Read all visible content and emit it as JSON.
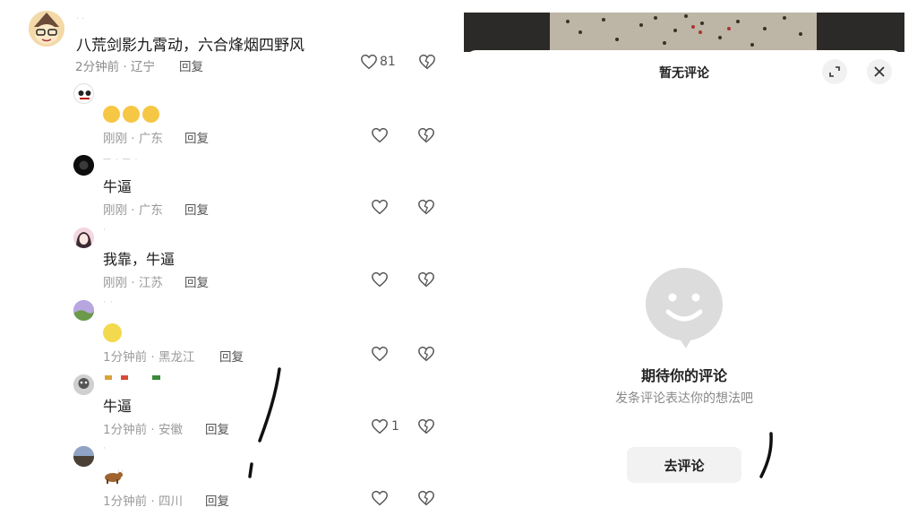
{
  "left": {
    "top_comment": {
      "username": "· ·",
      "text": "八荒剑影九霄动，六合烽烟四野风",
      "meta": "2分钟前 · 辽宁",
      "reply_label": "回复",
      "like_count": "81",
      "avatar_icon": "cartoon-avatar"
    },
    "replies": [
      {
        "username": "",
        "emojis": [
          "fearful-face-emoji",
          "fearful-face-emoji",
          "fearful-face-emoji"
        ],
        "text": "",
        "meta": "刚刚 · 广东",
        "reply_label": "回复",
        "like_count": ""
      },
      {
        "username": "一 · 一 ·",
        "emojis": [],
        "text": "牛逼",
        "meta": "刚刚 · 广东",
        "reply_label": "回复",
        "like_count": ""
      },
      {
        "username": "·",
        "emojis": [],
        "text": "我靠，牛逼",
        "meta": "刚刚 · 江苏",
        "reply_label": "回复",
        "like_count": ""
      },
      {
        "username": "· ·",
        "emojis": [
          "smiling-face-emoji"
        ],
        "text": "",
        "meta": "1分钟前 · 黑龙江",
        "reply_label": "回复",
        "like_count": ""
      },
      {
        "username": "",
        "emojis": [],
        "text": "牛逼",
        "meta": "1分钟前 · 安徽",
        "reply_label": "回复",
        "like_count": "1"
      },
      {
        "username": "·",
        "emojis": [
          "ox-emoji"
        ],
        "text": "",
        "meta": "1分钟前 · 四川",
        "reply_label": "回复",
        "like_count": ""
      }
    ],
    "colors": {
      "meta": "#9a9a9a",
      "text": "#1a1a1a"
    }
  },
  "right": {
    "sheet_title": "暂无评论",
    "expand_icon": "expand-icon",
    "close_icon": "close-icon",
    "empty_icon": "smiley-bubble-icon",
    "empty_title": "期待你的评论",
    "empty_subtitle": "发条评论表达你的想法吧",
    "go_comment_label": "去评论",
    "colors": {
      "sheet_bg": "#ffffff",
      "button_bg": "#f2f2f2",
      "icon_gray": "#dcdcdc"
    }
  }
}
